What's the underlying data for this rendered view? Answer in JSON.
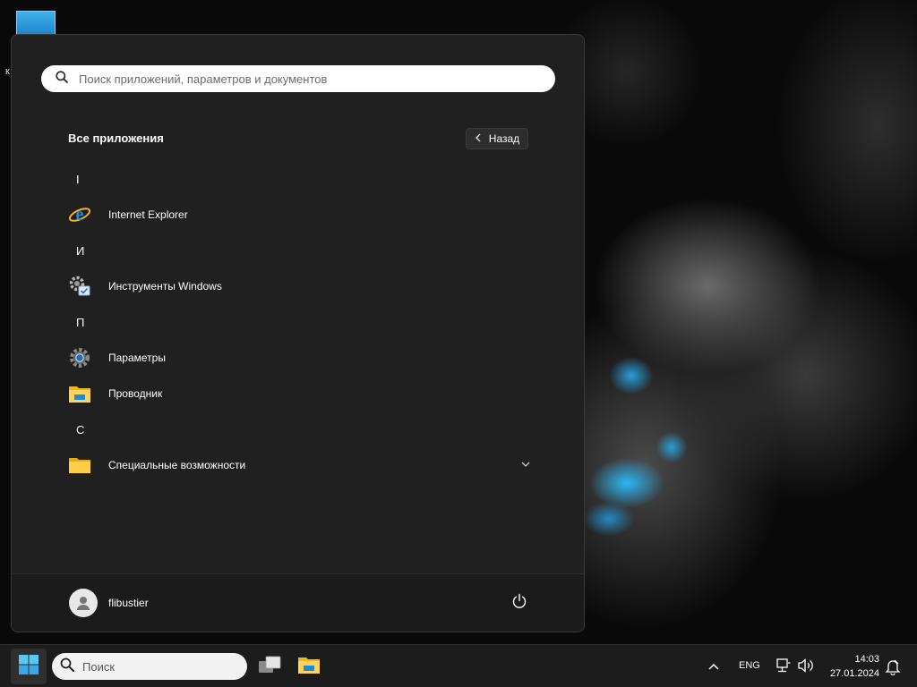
{
  "desktop": {
    "icon_label_fragment": "к"
  },
  "start_menu": {
    "search": {
      "placeholder": "Поиск приложений, параметров и документов"
    },
    "section_title": "Все приложения",
    "back_button": "Назад",
    "groups": [
      {
        "letter": "I",
        "apps": [
          {
            "name": "Internet Explorer",
            "icon": "internet-explorer-icon"
          }
        ]
      },
      {
        "letter": "И",
        "apps": [
          {
            "name": "Инструменты Windows",
            "icon": "windows-tools-icon"
          }
        ]
      },
      {
        "letter": "П",
        "apps": [
          {
            "name": "Параметры",
            "icon": "settings-gear-icon"
          },
          {
            "name": "Проводник",
            "icon": "file-explorer-icon"
          }
        ]
      },
      {
        "letter": "С",
        "apps": [
          {
            "name": "Специальные возможности",
            "icon": "folder-icon",
            "expandable": true
          }
        ]
      }
    ],
    "user": {
      "name": "flibustier"
    }
  },
  "taskbar": {
    "search_label": "Поиск",
    "language": "ENG",
    "time": "14:03",
    "date": "27.01.2024"
  }
}
